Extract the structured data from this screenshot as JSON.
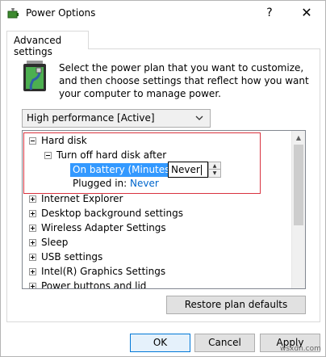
{
  "window": {
    "title": "Power Options",
    "help": "?",
    "close": "✕"
  },
  "tabs": [
    {
      "label": "Advanced settings"
    }
  ],
  "description": "Select the power plan that you want to customize, and then choose settings that reflect how you want your computer to manage power.",
  "plan_select": {
    "value": "High performance [Active]"
  },
  "tree": {
    "hard_disk": {
      "label": "Hard disk"
    },
    "turn_off": {
      "label": "Turn off hard disk after"
    },
    "on_battery": {
      "label": "On battery (Minutes):",
      "value": "Never"
    },
    "plugged_in": {
      "label": "Plugged in:",
      "value": "Never"
    },
    "items": [
      "Internet Explorer",
      "Desktop background settings",
      "Wireless Adapter Settings",
      "Sleep",
      "USB settings",
      "Intel(R) Graphics Settings",
      "Power buttons and lid"
    ]
  },
  "buttons": {
    "restore": "Restore plan defaults",
    "ok": "OK",
    "cancel": "Cancel",
    "apply": "Apply"
  },
  "watermark": "wsxdn.com",
  "colors": {
    "selection": "#3399ff",
    "highlight_box": "#d9333f",
    "link": "#0066cc",
    "primary_border": "#0078d7"
  }
}
